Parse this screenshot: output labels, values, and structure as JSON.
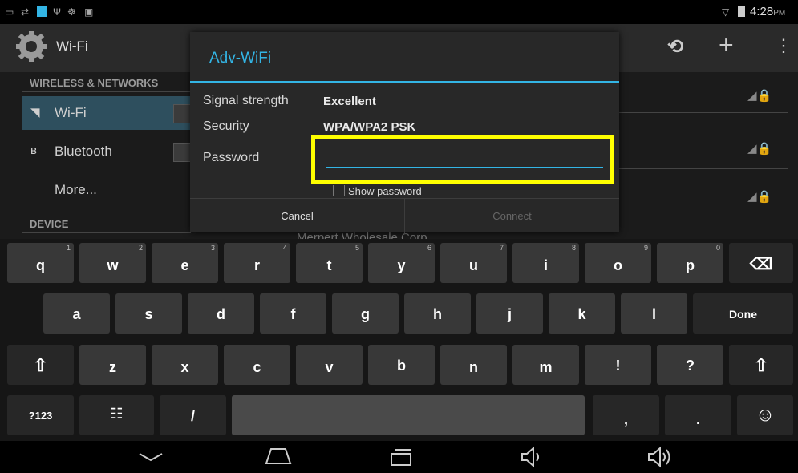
{
  "status_bar": {
    "time": "4:28",
    "ampm": "PM",
    "left_icons": [
      "screen-icon",
      "usb-icon",
      "keyboard-icon",
      "usb-debug-icon",
      "android-icon",
      "bag-icon"
    ]
  },
  "action_bar": {
    "title": "Wi-Fi"
  },
  "settings": {
    "wireless_header": "WIRELESS & NETWORKS",
    "wifi_label": "Wi-Fi",
    "bluetooth_label": "Bluetooth",
    "more_label": "More...",
    "device_header": "DEVICE",
    "network_behind": "Merpert Wholesale Corp"
  },
  "dialog": {
    "title": "Adv-WiFi",
    "signal_label": "Signal strength",
    "signal_value": "Excellent",
    "security_label": "Security",
    "security_value": "WPA/WPA2 PSK",
    "password_label": "Password",
    "password_value": "",
    "show_password_label": "Show password",
    "cancel_label": "Cancel",
    "connect_label": "Connect"
  },
  "keyboard": {
    "row1": [
      {
        "k": "q",
        "n": "1"
      },
      {
        "k": "w",
        "n": "2"
      },
      {
        "k": "e",
        "n": "3"
      },
      {
        "k": "r",
        "n": "4"
      },
      {
        "k": "t",
        "n": "5"
      },
      {
        "k": "y",
        "n": "6"
      },
      {
        "k": "u",
        "n": "7"
      },
      {
        "k": "i",
        "n": "8"
      },
      {
        "k": "o",
        "n": "9"
      },
      {
        "k": "p",
        "n": "0"
      }
    ],
    "row2": [
      "a",
      "s",
      "d",
      "f",
      "g",
      "h",
      "j",
      "k",
      "l"
    ],
    "row3": [
      "z",
      "x",
      "c",
      "v",
      "b",
      "n",
      "m",
      "!",
      "?"
    ],
    "done_label": "Done",
    "symbols_label": "?123",
    "slash_label": "/",
    "comma_label": ",",
    "period_label": ".",
    "backspace_glyph": "⌫",
    "shift_glyph": "⇧",
    "settings_glyph": "☷",
    "emoji_glyph": "☺"
  },
  "nav_bar": {
    "icons": [
      "hide-keyboard-icon",
      "home-icon",
      "recents-icon",
      "volume-down-icon",
      "volume-up-icon"
    ]
  },
  "colors": {
    "accent": "#33b5e5",
    "highlight": "#ffff00"
  }
}
